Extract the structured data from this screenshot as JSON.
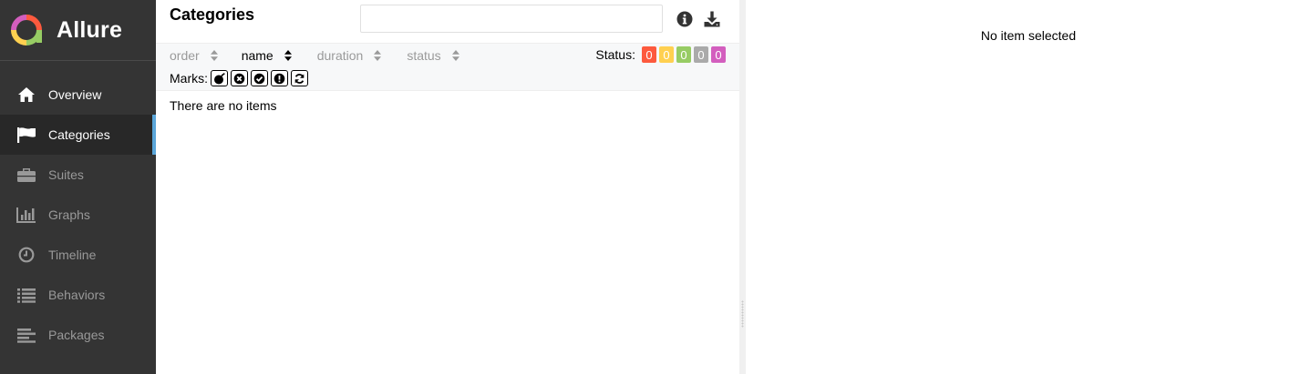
{
  "app": {
    "name": "Allure"
  },
  "sidebar": {
    "items": [
      {
        "label": "Overview",
        "icon": "home-icon"
      },
      {
        "label": "Categories",
        "icon": "flag-icon",
        "active": true
      },
      {
        "label": "Suites",
        "icon": "briefcase-icon"
      },
      {
        "label": "Graphs",
        "icon": "bar-chart-icon"
      },
      {
        "label": "Timeline",
        "icon": "clock-icon"
      },
      {
        "label": "Behaviors",
        "icon": "list-icon"
      },
      {
        "label": "Packages",
        "icon": "align-left-icon"
      }
    ]
  },
  "main": {
    "title": "Categories",
    "search": {
      "value": "",
      "placeholder": ""
    },
    "icons": [
      "info-icon",
      "download-icon"
    ],
    "sort": {
      "columns": [
        {
          "label": "order",
          "active": false
        },
        {
          "label": "name",
          "active": true
        },
        {
          "label": "duration",
          "active": false
        },
        {
          "label": "status",
          "active": false
        }
      ]
    },
    "status_filter": {
      "label": "Status:",
      "badges": [
        {
          "status": "failed",
          "count": "0",
          "color": "#fd5a3e"
        },
        {
          "status": "broken",
          "count": "0",
          "color": "#ffd050"
        },
        {
          "status": "passed",
          "count": "0",
          "color": "#97cc64"
        },
        {
          "status": "skipped",
          "count": "0",
          "color": "#aaaaaa"
        },
        {
          "status": "unknown",
          "count": "0",
          "color": "#d35ebe"
        }
      ]
    },
    "marks": {
      "label": "Marks:",
      "icons": [
        "bomb-icon",
        "times-circle-icon",
        "check-circle-icon",
        "exclamation-circle-icon",
        "refresh-icon"
      ]
    },
    "empty_text": "There are no items"
  },
  "detail": {
    "empty_text": "No item selected"
  },
  "colors": {
    "sidebar_bg": "#343434",
    "active_accent": "#5ba6d9"
  }
}
